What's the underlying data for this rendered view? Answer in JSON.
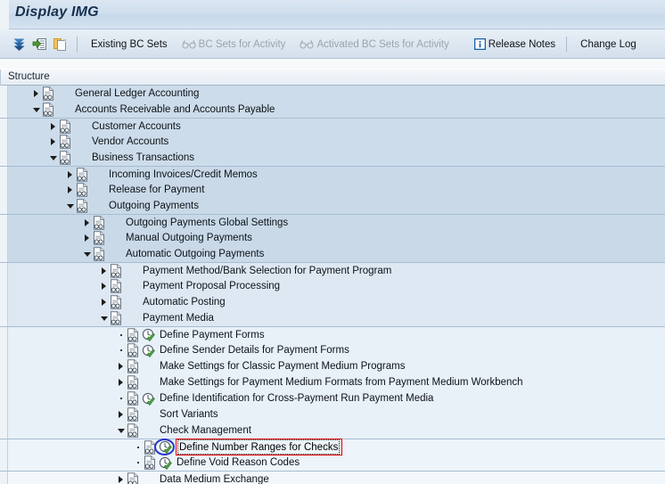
{
  "window": {
    "title": "Display IMG"
  },
  "toolbar": {
    "icons": [
      {
        "name": "collapse-all-icon",
        "label": ""
      },
      {
        "name": "expand-subtree-icon",
        "label": ""
      },
      {
        "name": "copy-icon",
        "label": ""
      }
    ],
    "buttons": [
      {
        "name": "existing-bc-sets-button",
        "label": "Existing BC Sets",
        "icon": "none",
        "disabled": false
      },
      {
        "name": "bc-sets-for-activity-button",
        "label": "BC Sets for Activity",
        "icon": "glasses-icon",
        "disabled": true
      },
      {
        "name": "activated-bc-sets-for-activity-button",
        "label": "Activated BC Sets for Activity",
        "icon": "glasses-icon",
        "disabled": true
      },
      {
        "name": "release-notes-button",
        "label": "Release Notes",
        "icon": "info-icon",
        "disabled": false
      },
      {
        "name": "change-log-button",
        "label": "Change Log",
        "icon": "none",
        "disabled": false
      }
    ]
  },
  "column_header": {
    "structure": "Structure"
  },
  "colors": {
    "title_text": "#16304d",
    "titlebar": "#cfdeee",
    "annotation_red": "#e00000",
    "annotation_blue": "#2a36c8",
    "activity_green": "#4ca64c"
  },
  "tree": {
    "rows": [
      {
        "name": "tree-node-general-ledger-accounting",
        "label": "General Ledger Accounting",
        "depth": 1,
        "state": "collapsed",
        "activity": false,
        "band": 0,
        "band_start": false,
        "highlight": false
      },
      {
        "name": "tree-node-accounts-receivable-and-accounts-payable",
        "label": "Accounts Receivable and Accounts Payable",
        "depth": 1,
        "state": "expanded",
        "activity": false,
        "band": 0,
        "band_start": false,
        "highlight": false
      },
      {
        "name": "tree-node-customer-accounts",
        "label": "Customer Accounts",
        "depth": 2,
        "state": "collapsed",
        "activity": false,
        "band": 1,
        "band_start": true,
        "highlight": false
      },
      {
        "name": "tree-node-vendor-accounts",
        "label": "Vendor Accounts",
        "depth": 2,
        "state": "collapsed",
        "activity": false,
        "band": 1,
        "band_start": false,
        "highlight": false
      },
      {
        "name": "tree-node-business-transactions",
        "label": "Business Transactions",
        "depth": 2,
        "state": "expanded",
        "activity": false,
        "band": 1,
        "band_start": false,
        "highlight": false
      },
      {
        "name": "tree-node-incoming-invoices-credit-memos",
        "label": "Incoming Invoices/Credit Memos",
        "depth": 3,
        "state": "collapsed",
        "activity": false,
        "band": 2,
        "band_start": true,
        "highlight": false
      },
      {
        "name": "tree-node-release-for-payment",
        "label": "Release for Payment",
        "depth": 3,
        "state": "collapsed",
        "activity": false,
        "band": 2,
        "band_start": false,
        "highlight": false
      },
      {
        "name": "tree-node-outgoing-payments",
        "label": "Outgoing Payments",
        "depth": 3,
        "state": "expanded",
        "activity": false,
        "band": 2,
        "band_start": false,
        "highlight": false
      },
      {
        "name": "tree-node-outgoing-payments-global-settings",
        "label": "Outgoing Payments Global Settings",
        "depth": 4,
        "state": "collapsed",
        "activity": false,
        "band": 3,
        "band_start": true,
        "highlight": false
      },
      {
        "name": "tree-node-manual-outgoing-payments",
        "label": "Manual Outgoing Payments",
        "depth": 4,
        "state": "collapsed",
        "activity": false,
        "band": 3,
        "band_start": false,
        "highlight": false
      },
      {
        "name": "tree-node-automatic-outgoing-payments",
        "label": "Automatic Outgoing Payments",
        "depth": 4,
        "state": "expanded",
        "activity": false,
        "band": 3,
        "band_start": false,
        "highlight": false
      },
      {
        "name": "tree-node-payment-method-bank-selection-for-payment-program",
        "label": "Payment Method/Bank Selection for Payment Program",
        "depth": 5,
        "state": "collapsed",
        "activity": false,
        "band": 4,
        "band_start": true,
        "highlight": false
      },
      {
        "name": "tree-node-payment-proposal-processing",
        "label": "Payment Proposal Processing",
        "depth": 5,
        "state": "collapsed",
        "activity": false,
        "band": 4,
        "band_start": false,
        "highlight": false
      },
      {
        "name": "tree-node-automatic-posting",
        "label": "Automatic Posting",
        "depth": 5,
        "state": "collapsed",
        "activity": false,
        "band": 4,
        "band_start": false,
        "highlight": false
      },
      {
        "name": "tree-node-payment-media",
        "label": "Payment Media",
        "depth": 5,
        "state": "expanded",
        "activity": false,
        "band": 4,
        "band_start": false,
        "highlight": false
      },
      {
        "name": "tree-node-define-payment-forms",
        "label": "Define Payment Forms",
        "depth": 6,
        "state": "leaf",
        "activity": true,
        "band": 5,
        "band_start": true,
        "highlight": false
      },
      {
        "name": "tree-node-define-sender-details-for-payment-forms",
        "label": "Define Sender Details for Payment Forms",
        "depth": 6,
        "state": "leaf",
        "activity": true,
        "band": 5,
        "band_start": false,
        "highlight": false
      },
      {
        "name": "tree-node-make-settings-for-classic-payment-medium-programs",
        "label": "Make Settings for Classic Payment Medium Programs",
        "depth": 6,
        "state": "collapsed",
        "activity": false,
        "band": 5,
        "band_start": false,
        "highlight": false
      },
      {
        "name": "tree-node-make-settings-for-payment-medium-formats-from-payment-medium-workbench",
        "label": "Make Settings for Payment Medium Formats from Payment Medium Workbench",
        "depth": 6,
        "state": "collapsed",
        "activity": false,
        "band": 5,
        "band_start": false,
        "highlight": false
      },
      {
        "name": "tree-node-define-identification-for-cross-payment-run-payment-media",
        "label": "Define Identification for Cross-Payment Run Payment Media",
        "depth": 6,
        "state": "leaf",
        "activity": true,
        "band": 5,
        "band_start": false,
        "highlight": false
      },
      {
        "name": "tree-node-sort-variants",
        "label": "Sort Variants",
        "depth": 6,
        "state": "collapsed",
        "activity": false,
        "band": 5,
        "band_start": false,
        "highlight": false
      },
      {
        "name": "tree-node-check-management",
        "label": "Check Management",
        "depth": 6,
        "state": "expanded",
        "activity": false,
        "band": 5,
        "band_start": false,
        "highlight": false
      },
      {
        "name": "tree-node-define-number-ranges-for-checks",
        "label": "Define Number Ranges for Checks",
        "depth": 7,
        "state": "leaf",
        "activity": true,
        "band": 6,
        "band_start": true,
        "highlight": true
      },
      {
        "name": "tree-node-define-void-reason-codes",
        "label": "Define Void Reason Codes",
        "depth": 7,
        "state": "leaf",
        "activity": true,
        "band": 6,
        "band_start": false,
        "highlight": false
      },
      {
        "name": "tree-node-data-medium-exchange",
        "label": "Data Medium Exchange",
        "depth": 6,
        "state": "collapsed",
        "activity": false,
        "band": 7,
        "band_start": true,
        "highlight": false
      }
    ]
  },
  "annotations": {
    "circle_target": "activity-icon of Define Number Ranges for Checks",
    "box_target": "Define Number Ranges for Checks"
  }
}
